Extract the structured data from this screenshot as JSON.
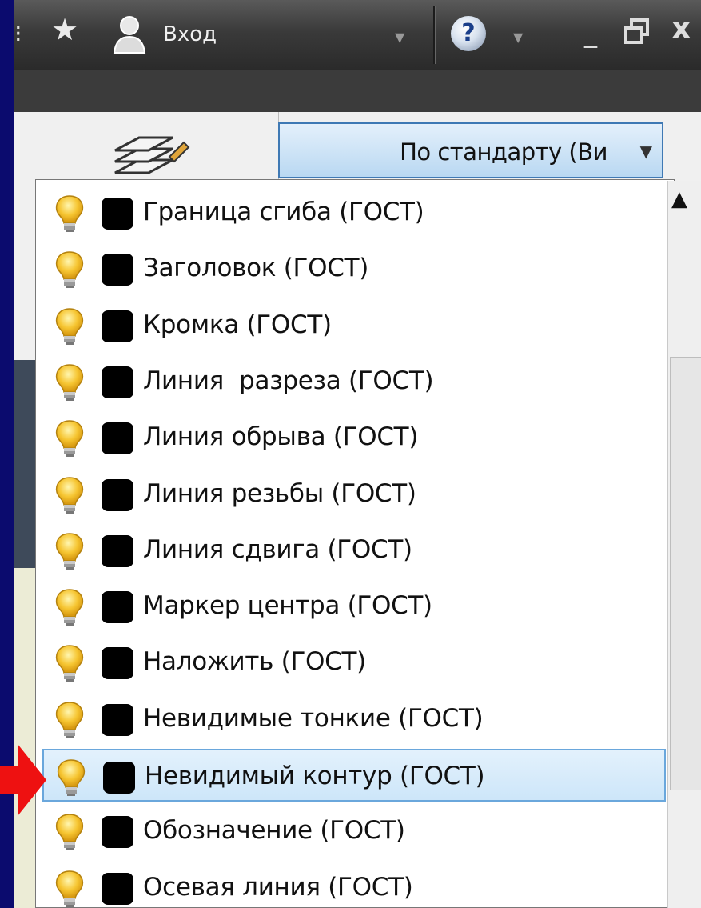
{
  "titlebar": {
    "login_label": "Вход",
    "help_symbol": "?",
    "minimize_symbol": "_",
    "close_symbol": "x"
  },
  "combo": {
    "selected_value": "По стандарту (Ви"
  },
  "layers": [
    {
      "label": "Граница сгиба (ГОСТ)",
      "selected": false
    },
    {
      "label": "Заголовок (ГОСТ)",
      "selected": false
    },
    {
      "label": "Кромка (ГОСТ)",
      "selected": false
    },
    {
      "label": "Линия  разреза (ГОСТ)",
      "selected": false
    },
    {
      "label": "Линия обрыва (ГОСТ)",
      "selected": false
    },
    {
      "label": "Линия резьбы (ГОСТ)",
      "selected": false
    },
    {
      "label": "Линия сдвига (ГОСТ)",
      "selected": false
    },
    {
      "label": "Маркер центра (ГОСТ)",
      "selected": false
    },
    {
      "label": "Наложить (ГОСТ)",
      "selected": false
    },
    {
      "label": "Невидимые тонкие (ГОСТ)",
      "selected": false
    },
    {
      "label": "Невидимый контур (ГОСТ)",
      "selected": true
    },
    {
      "label": "Обозначение (ГОСТ)",
      "selected": false
    },
    {
      "label": "Осевая линия (ГОСТ)",
      "selected": false
    }
  ],
  "icons": {
    "visibility": "lightbulb-icon",
    "color": "color-swatch-icon",
    "pointer": "red-arrow-icon"
  },
  "colors": {
    "background": "#0b0b6e",
    "swatch": "#000000",
    "selection": "#cde6f9",
    "arrow": "#ee1111"
  }
}
